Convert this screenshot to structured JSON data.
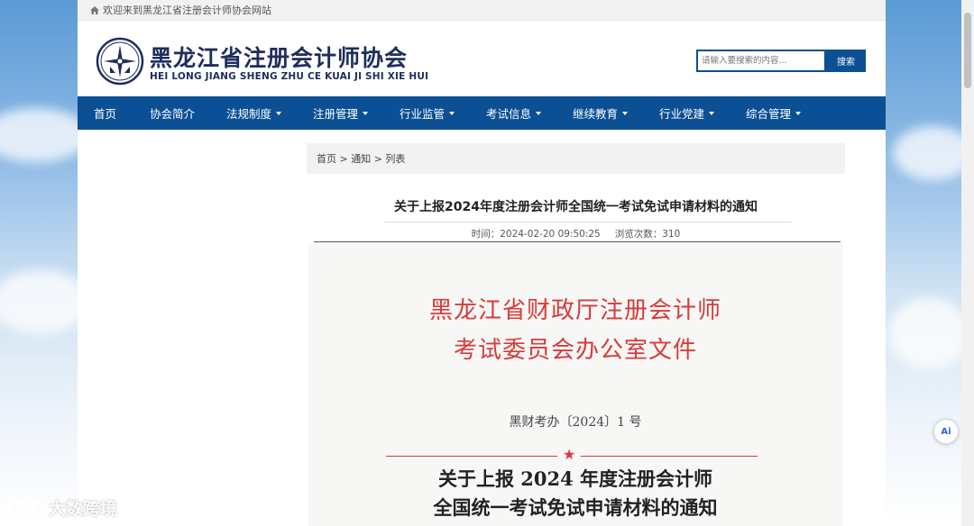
{
  "topbar": {
    "welcome": "欢迎来到黑龙江省注册会计师协会网站"
  },
  "header": {
    "title_cn": "黑龙江省注册会计师协会",
    "title_en": "HEI LONG JIANG SHENG ZHU CE KUAI JI SHI XIE HUI"
  },
  "search": {
    "placeholder": "请输入要搜索的内容...",
    "button": "搜索"
  },
  "nav": [
    {
      "label": "首页",
      "dropdown": false
    },
    {
      "label": "协会简介",
      "dropdown": false
    },
    {
      "label": "法规制度",
      "dropdown": true
    },
    {
      "label": "注册管理",
      "dropdown": true
    },
    {
      "label": "行业监管",
      "dropdown": true
    },
    {
      "label": "考试信息",
      "dropdown": true
    },
    {
      "label": "继续教育",
      "dropdown": true
    },
    {
      "label": "行业党建",
      "dropdown": true
    },
    {
      "label": "综合管理",
      "dropdown": true
    }
  ],
  "breadcrumb": {
    "text": "首页 > 通知 > 列表"
  },
  "article": {
    "title": "关于上报2024年度注册会计师全国统一考试免试申请材料的通知",
    "time_label": "时间：2024-02-20 09:50:25",
    "views_label": "浏览次数：310"
  },
  "document": {
    "red_title_1": "黑龙江省财政厅注册会计师",
    "red_title_2": "考试委员会办公室文件",
    "doc_number": "黑财考办〔2024〕1 号",
    "heading_1": "关于上报 2024 年度注册会计师",
    "heading_2": "全国统一考试免试申请材料的通知"
  },
  "ai_badge": {
    "label": "Ai"
  },
  "watermark": {
    "text": "大数跨境"
  },
  "colors": {
    "nav_bg": "#0b4f94",
    "doc_red": "#d83a3a",
    "title_navy": "#1f2d5c"
  }
}
